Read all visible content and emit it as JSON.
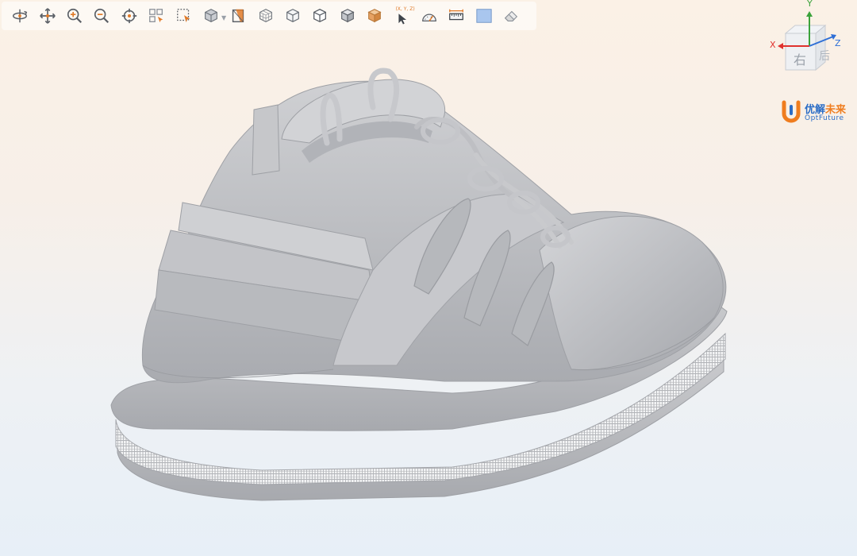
{
  "toolbar": {
    "tools": [
      {
        "icon": "rotate-icon"
      },
      {
        "icon": "pan-icon"
      },
      {
        "icon": "zoom-in-icon"
      },
      {
        "icon": "zoom-out-icon"
      },
      {
        "icon": "fit-view-icon"
      },
      {
        "icon": "box-select-icon"
      },
      {
        "icon": "window-select-icon"
      },
      {
        "icon": "view-cube-dropdown-icon"
      },
      {
        "icon": "section-plane-icon"
      },
      {
        "icon": "wireframe-cube-icon"
      },
      {
        "icon": "hidden-line-cube-icon"
      },
      {
        "icon": "outline-cube-icon"
      },
      {
        "icon": "shaded-cube-icon"
      },
      {
        "icon": "solid-cube-icon"
      },
      {
        "icon": "pick-point-icon"
      },
      {
        "icon": "measure-angle-icon"
      },
      {
        "icon": "measure-distance-icon"
      },
      {
        "icon": "background-color-icon"
      },
      {
        "icon": "eraser-icon"
      }
    ],
    "pick_point_tag": "(X, Y, Z)"
  },
  "viewcube": {
    "x_label": "X",
    "y_label": "Y",
    "z_label": "Z",
    "face_label": "右",
    "side_label": "后",
    "colors": {
      "x": "#e0322e",
      "y": "#3aa23a",
      "z": "#2f6fd6"
    }
  },
  "logo": {
    "cn_primary": "优解",
    "cn_accent": "未来",
    "en": "OptFuture",
    "colors": {
      "blue": "#2a6cc6",
      "orange": "#ef7d1f"
    }
  },
  "model": {
    "name": "shoe-model",
    "colors": {
      "body": "#bdbec2",
      "shade": "#a4a6ab",
      "highlight": "#d8d9dc",
      "lattice": "#e9eaec"
    }
  }
}
